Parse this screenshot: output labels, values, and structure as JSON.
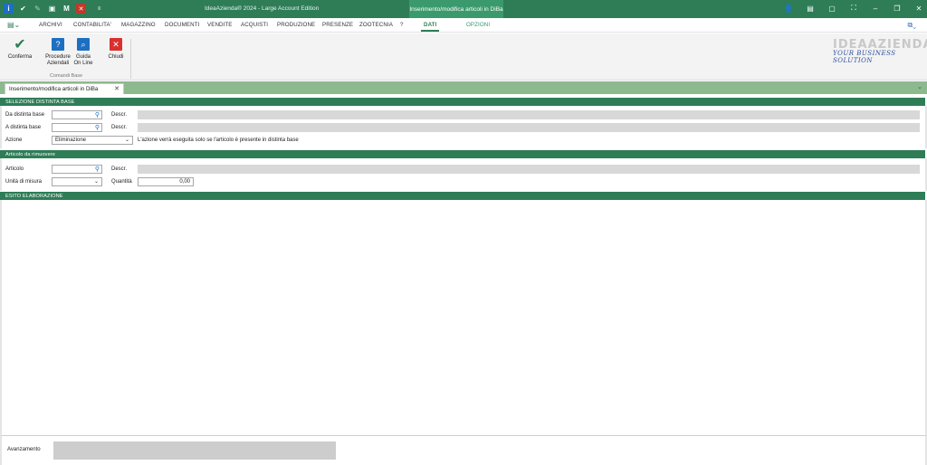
{
  "app": {
    "title": "IdeaAzienda® 2024 - Large Account Edition",
    "context_tab": "Inserimento/modifica articoli in DiBa"
  },
  "menu": {
    "items": [
      "ARCHIVI",
      "CONTABILITA'",
      "MAGAZZINO",
      "DOCUMENTI",
      "VENDITE",
      "ACQUISTI",
      "PRODUZIONE",
      "PRESENZE",
      "ZOOTECNIA",
      "?"
    ],
    "active": "DATI",
    "opzioni": "OPZIONI"
  },
  "ribbon": {
    "conferma": "Conferma",
    "procedure_line1": "Procedure",
    "procedure_line2": "Aziendali",
    "guida_line1": "Guida",
    "guida_line2": "On Line",
    "chiudi": "Chiudi",
    "group_label": "Comandi Base",
    "logo_line1": "IDEAAZIENDA",
    "logo_line2": "YOUR BUSINESS SOLUTION"
  },
  "doc_tab": {
    "title": "Inserimento/modifica articoli in DiBa"
  },
  "section1": {
    "header": "SELEZIONE DISTINTA BASE",
    "da_distinta": "Da distinta base",
    "a_distinta": "A distinta base",
    "azione": "Azione",
    "descr": "Descr.",
    "azione_value": "Eliminazione",
    "note": "L'azione verrà eseguita solo se l'articolo è presente in distinta base"
  },
  "section2": {
    "header": "Articolo da rimuovere",
    "articolo": "Articolo",
    "unita": "Unità di misura",
    "descr": "Descr.",
    "quantita": "Quantità",
    "quantita_value": "0,00"
  },
  "section3": {
    "header": "ESITO ELABORAZIONE"
  },
  "bottom": {
    "avanzamento": "Avanzamento",
    "progress": 0
  }
}
